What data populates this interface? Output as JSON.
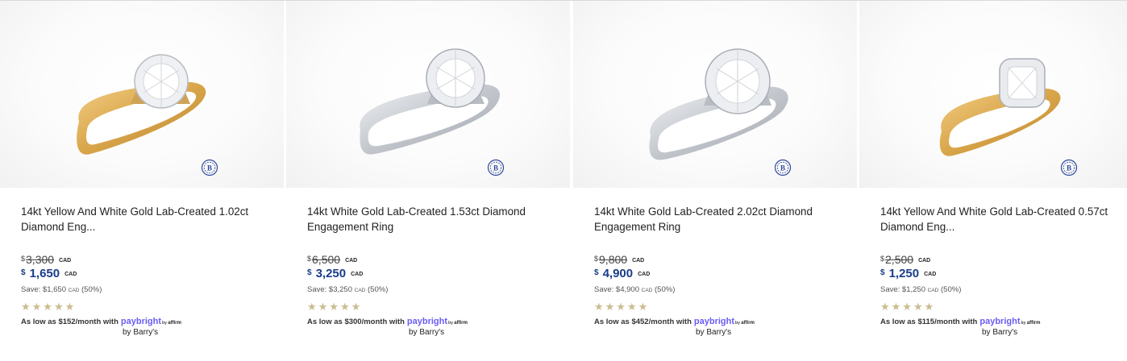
{
  "products": [
    {
      "title": "14kt Yellow And White Gold Lab-Created 1.02ct Diamond Eng...",
      "currency_symbol": "$",
      "old_price": "3,300",
      "new_price": "1,650",
      "currency": "CAD",
      "save_text": "Save: $1,650",
      "save_cad": "CAD",
      "save_pct": "(50%)",
      "rating": 5,
      "stars": "★★★★★",
      "as_low": "As low as $152/month with",
      "paybright": "paybright",
      "by_affirm_by": "by",
      "by_affirm_name": "affirm",
      "seller": "by Barry's",
      "metal": "yellow",
      "stone": "solitaire"
    },
    {
      "title": "14kt White Gold Lab-Created 1.53ct Diamond Engagement Ring",
      "currency_symbol": "$",
      "old_price": "6,500",
      "new_price": "3,250",
      "currency": "CAD",
      "save_text": "Save: $3,250",
      "save_cad": "CAD",
      "save_pct": "(50%)",
      "rating": 5,
      "stars": "★★★★★",
      "as_low": "As low as $300/month with",
      "paybright": "paybright",
      "by_affirm_by": "by",
      "by_affirm_name": "affirm",
      "seller": "by Barry's",
      "metal": "white",
      "stone": "solitaire"
    },
    {
      "title": "14kt White Gold Lab-Created 2.02ct Diamond Engagement Ring",
      "currency_symbol": "$",
      "old_price": "9,800",
      "new_price": "4,900",
      "currency": "CAD",
      "save_text": "Save: $4,900",
      "save_cad": "CAD",
      "save_pct": "(50%)",
      "rating": 5,
      "stars": "★★★★★",
      "as_low": "As low as $452/month with",
      "paybright": "paybright",
      "by_affirm_by": "by",
      "by_affirm_name": "affirm",
      "seller": "by Barry's",
      "metal": "white",
      "stone": "solitaire-large"
    },
    {
      "title": "14kt Yellow And White Gold Lab-Created 0.57ct Diamond Eng...",
      "currency_symbol": "$",
      "old_price": "2,500",
      "new_price": "1,250",
      "currency": "CAD",
      "save_text": "Save: $1,250",
      "save_cad": "CAD",
      "save_pct": "(50%)",
      "rating": 5,
      "stars": "★★★★★",
      "as_low": "As low as $115/month with",
      "paybright": "paybright",
      "by_affirm_by": "by",
      "by_affirm_name": "affirm",
      "seller": "by Barry's",
      "metal": "yellow",
      "stone": "halo"
    }
  ],
  "colors": {
    "price_blue": "#1a3c8a",
    "star_gold": "#c9bc8e",
    "paybright_purple": "#6a5cf5",
    "badge_blue": "#2e4a9e",
    "yellow_gold": "#d9a54a",
    "white_gold": "#c9cdd3"
  },
  "icons": {
    "badge": "barrys-b-badge-icon",
    "star": "star-icon"
  }
}
